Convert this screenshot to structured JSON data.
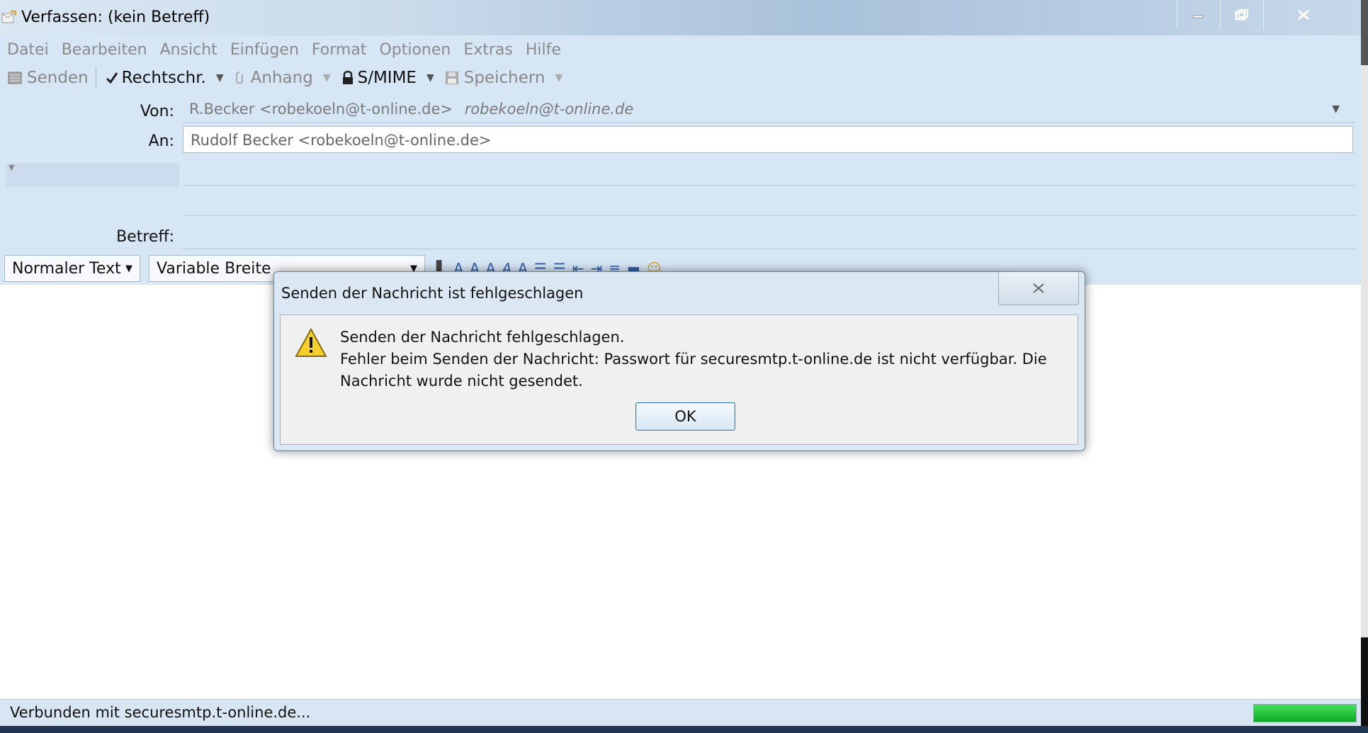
{
  "window": {
    "title": "Verfassen: (kein Betreff)",
    "controls": [
      "minimize",
      "restore",
      "close"
    ]
  },
  "menu": [
    "Datei",
    "Bearbeiten",
    "Ansicht",
    "Einfügen",
    "Format",
    "Optionen",
    "Extras",
    "Hilfe"
  ],
  "toolbar": {
    "send": "Senden",
    "spelling": "Rechtschr.",
    "attach": "Anhang",
    "smime": "S/MIME",
    "save": "Speichern"
  },
  "header": {
    "from_label": "Von:",
    "from_value": "R.Becker <robekoeln@t-online.de>",
    "from_account": "robekoeln@t-online.de",
    "to_label": "An:",
    "to_value": "Rudolf Becker <robekoeln@t-online.de>",
    "subject_label": "Betreff:"
  },
  "format": {
    "paragraph": "Normaler Text",
    "font": "Variable Breite"
  },
  "dialog": {
    "title": "Senden der Nachricht ist fehlgeschlagen",
    "message_line1": "Senden der Nachricht fehlgeschlagen.",
    "message_line2": "Fehler beim Senden der Nachricht: Passwort für securesmtp.t-online.de ist nicht verfügbar. Die Nachricht wurde nicht gesendet.",
    "ok": "OK"
  },
  "status": {
    "text": "Verbunden mit securesmtp.t-online.de...",
    "progress_pct": 100
  },
  "colors": {
    "frame": "#d6e6f5",
    "progress": "#19c12f",
    "ok_border": "#3c7fb1"
  }
}
